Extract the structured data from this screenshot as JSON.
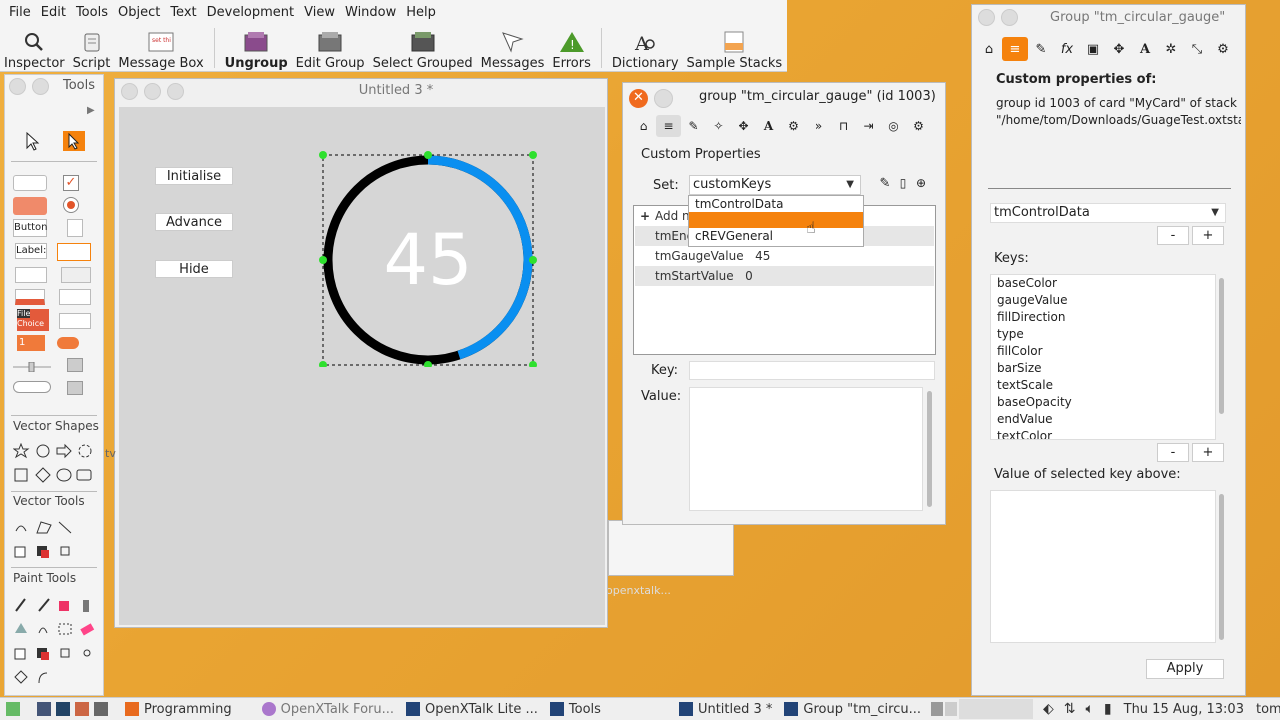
{
  "menubar": [
    "File",
    "Edit",
    "Tools",
    "Object",
    "Text",
    "Development",
    "View",
    "Window",
    "Help"
  ],
  "toolbar": [
    {
      "label": "Inspector",
      "icon": "magnifier-icon"
    },
    {
      "label": "Script",
      "icon": "scroll-icon"
    },
    {
      "label": "Message Box",
      "icon": "message-box-icon"
    },
    {
      "label": "Ungroup",
      "icon": "ungroup-icon"
    },
    {
      "label": "Edit Group",
      "icon": "edit-group-icon"
    },
    {
      "label": "Select Grouped",
      "icon": "select-grouped-icon"
    },
    {
      "label": "Messages",
      "icon": "messages-icon"
    },
    {
      "label": "Errors",
      "icon": "warning-icon"
    },
    {
      "label": "Dictionary",
      "icon": "dictionary-icon"
    },
    {
      "label": "Sample Stacks",
      "icon": "sample-stacks-icon"
    }
  ],
  "tools": {
    "title": "Tools",
    "sections": {
      "vector_shapes": "Vector Shapes",
      "vector_tools": "Vector Tools",
      "paint_tools": "Paint Tools"
    },
    "button_sample": "Button",
    "label_sample": "Label:",
    "file_sample": "File",
    "choice_sample": "Choice",
    "number_sample": "1"
  },
  "stack": {
    "title": "Untitled 3 *",
    "buttons": {
      "initialise": "Initialise",
      "advance": "Advance",
      "hide": "Hide"
    },
    "gauge": {
      "value_text": "45",
      "value": 45,
      "start": 0,
      "end": 100,
      "fill_color": "#0a8ff0",
      "base_color": "#000000"
    }
  },
  "inspector": {
    "title": "group \"tm_circular_gauge\" (id 1003)",
    "section": "Custom Properties",
    "set_label": "Set:",
    "set_value": "customKeys",
    "add_new": "Add n",
    "rows": [
      {
        "key": "tmEnd",
        "value": ""
      },
      {
        "key": "tmGaugeValue",
        "value": "45"
      },
      {
        "key": "tmStartValue",
        "value": "0"
      }
    ],
    "key_label": "Key:",
    "value_label": "Value:",
    "dropdown": [
      "tmControlData",
      "",
      "cREVGeneral"
    ]
  },
  "right": {
    "title": "Group \"tm_circular_gauge\"",
    "heading": "Custom properties of:",
    "object_path_1": "group id 1003 of card \"MyCard\" of stack",
    "object_path_2": "\"/home/tom/Downloads/GuageTest.oxtstack",
    "set_value": "tmControlData",
    "minus": "-",
    "plus": "+",
    "keys_label": "Keys:",
    "keys": [
      "baseColor",
      "gaugeValue",
      "fillDirection",
      "type",
      "fillColor",
      "barSize",
      "textScale",
      "baseOpacity",
      "endValue",
      "textColor"
    ],
    "value_label": "Value of selected key above:",
    "apply": "Apply"
  },
  "background": {
    "text": "openxtalk..."
  },
  "taskbar": {
    "items": [
      "Programming",
      "OpenXTalk Foru...",
      "OpenXTalk Lite ...",
      "Tools",
      "Untitled 3 *",
      "Group \"tm_circu..."
    ],
    "clock": "Thu 15 Aug, 13:03",
    "user": "tom"
  }
}
